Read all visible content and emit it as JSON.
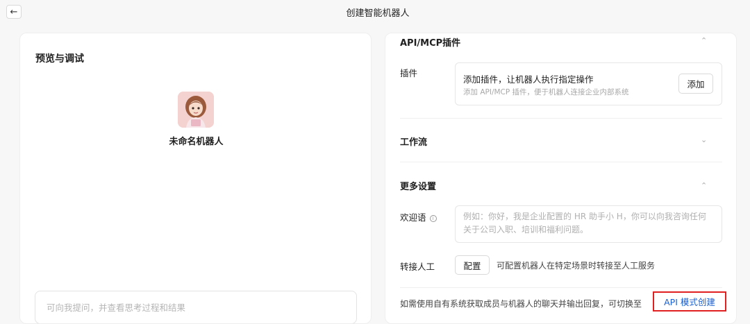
{
  "header": {
    "back_icon": "arrow-left-icon",
    "title": "创建智能机器人"
  },
  "preview": {
    "title": "预览与调试",
    "bot_name": "未命名机器人",
    "chat_placeholder": "可向我提问，并查看思考过程和结果"
  },
  "settings": {
    "plugins_section": {
      "title": "API/MCP插件",
      "row_label": "插件",
      "main_text": "添加插件，让机器人执行指定操作",
      "sub_text": "添加 API/MCP 插件，便于机器人连接企业内部系统",
      "add_label": "添加"
    },
    "workflow_section": {
      "title": "工作流"
    },
    "more_section": {
      "title": "更多设置",
      "welcome_label": "欢迎语",
      "welcome_placeholder": "例如：你好，我是企业配置的 HR 助手小 H，你可以向我咨询任何关于公司入职、培训和福利问题。",
      "transfer_label": "转接人工",
      "config_label": "配置",
      "config_desc": "可配置机器人在特定场景时转接至人工服务"
    },
    "footer_text": "如需使用自有系统获取成员与机器人的聊天并输出回复，可切换至",
    "api_link": "API 模式创建"
  },
  "colors": {
    "link": "#1a5fd0",
    "highlight_border": "#e02020"
  }
}
